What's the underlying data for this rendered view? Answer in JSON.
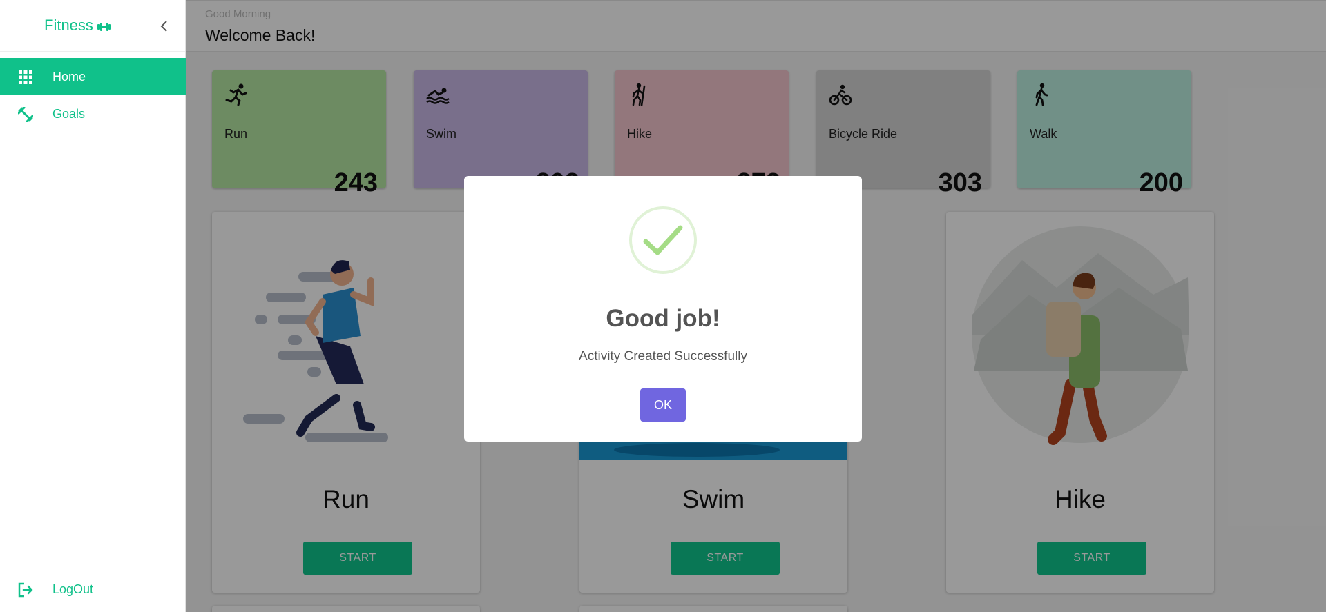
{
  "app": {
    "brand": "Fitness",
    "brand_color": "#10c18a"
  },
  "sidebar": {
    "items": [
      {
        "label": "Home",
        "icon": "grid-icon",
        "active": true
      },
      {
        "label": "Goals",
        "icon": "fitness-icon",
        "active": false
      }
    ],
    "logout_label": "LogOut"
  },
  "header": {
    "greeting": "Good Morning",
    "title": "Welcome Back!"
  },
  "stats": [
    {
      "name": "Run",
      "value": "243",
      "color": "#b6e8a4",
      "icon": "run-icon"
    },
    {
      "name": "Swim",
      "value": "203",
      "color": "#cab9e8",
      "icon": "swim-icon"
    },
    {
      "name": "Hike",
      "value": "273",
      "color": "#f5c7cf",
      "icon": "hike-icon"
    },
    {
      "name": "Bicycle Ride",
      "value": "303",
      "color": "#d6d6d6",
      "icon": "bicycle-icon"
    },
    {
      "name": "Walk",
      "value": "200",
      "color": "#bdf1e1",
      "icon": "walk-icon"
    }
  ],
  "activities": [
    {
      "title": "Run",
      "button": "START"
    },
    {
      "title": "Swim",
      "button": "START"
    },
    {
      "title": "Hike",
      "button": "START"
    }
  ],
  "modal": {
    "title": "Good job!",
    "message": "Activity Created Successfully",
    "ok_label": "OK",
    "ok_color": "#7066e0",
    "success_color": "#a5dc86"
  }
}
